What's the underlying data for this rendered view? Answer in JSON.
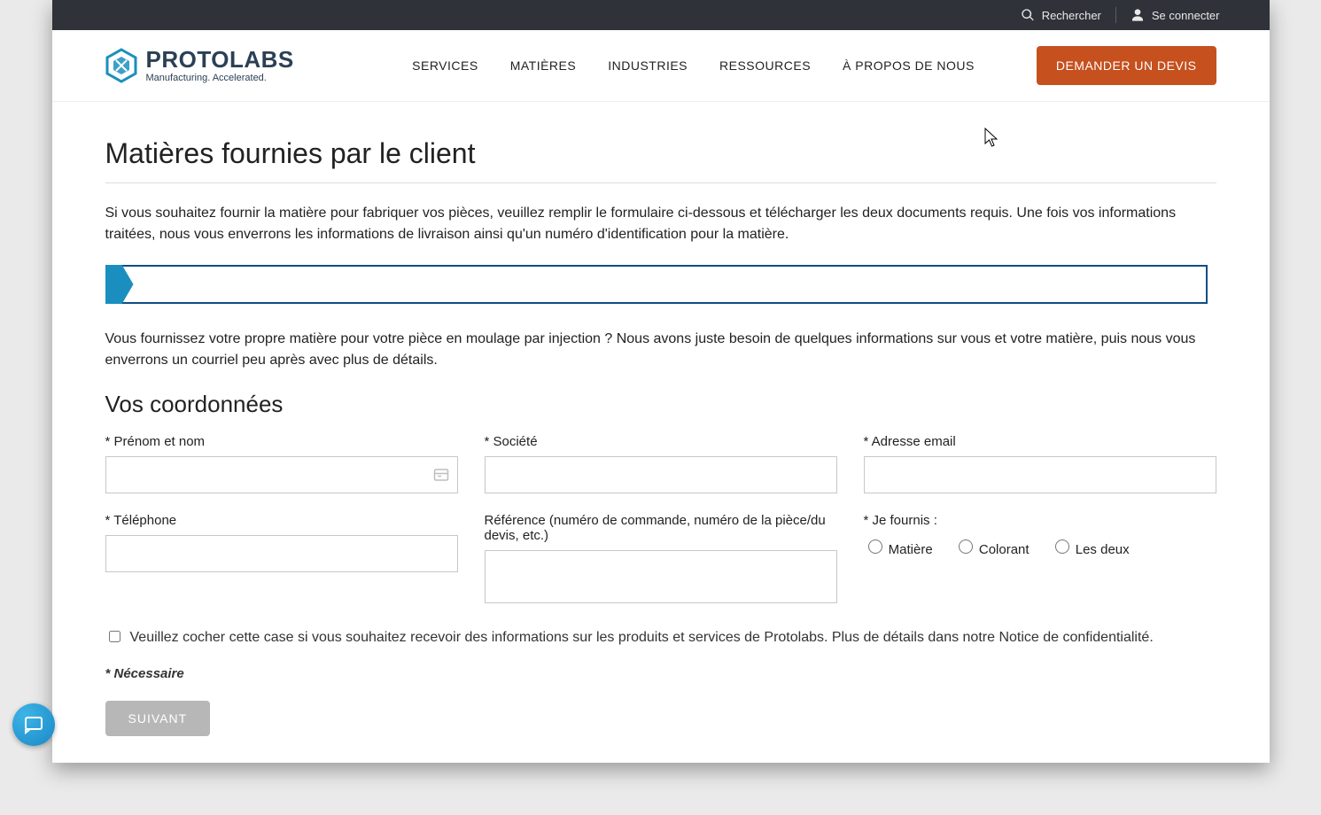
{
  "utility": {
    "search_label": "Rechercher",
    "signin_label": "Se connecter"
  },
  "brand": {
    "name": "PROTOLABS",
    "tagline": "Manufacturing. Accelerated."
  },
  "nav": {
    "items": [
      {
        "label": "SERVICES"
      },
      {
        "label": "MATIÈRES"
      },
      {
        "label": "INDUSTRIES"
      },
      {
        "label": "RESSOURCES"
      },
      {
        "label": "À PROPOS DE NOUS"
      }
    ],
    "cta_label": "DEMANDER UN DEVIS"
  },
  "page": {
    "title": "Matières fournies par le client",
    "intro": "Si vous souhaitez fournir la matière pour fabriquer vos pièces, veuillez remplir le formulaire ci-dessous et télécharger les deux documents requis. Une fois vos informations traitées, nous vous enverrons les informations de livraison ainsi qu'un numéro d'identification pour la matière.",
    "sub": "Vous fournissez votre propre matière pour votre pièce en moulage par injection ? Nous avons juste besoin de quelques informations sur vous et votre matière, puis nous vous enverrons un courriel peu après avec plus de détails."
  },
  "form": {
    "section_title": "Vos coordonnées",
    "fields": {
      "name": {
        "label": "* Prénom et nom",
        "value": ""
      },
      "company": {
        "label": "* Société",
        "value": ""
      },
      "email": {
        "label": "* Adresse email",
        "value": ""
      },
      "phone": {
        "label": "* Téléphone",
        "value": ""
      },
      "reference": {
        "label": "Référence (numéro de commande, numéro de la pièce/du devis, etc.)",
        "value": ""
      },
      "supply": {
        "label": "* Je fournis :",
        "options": [
          {
            "label": "Matière"
          },
          {
            "label": "Colorant"
          },
          {
            "label": "Les deux"
          }
        ]
      }
    },
    "consent_label": "Veuillez cocher cette case si vous souhaitez recevoir des informations sur les produits et services de Protolabs. Plus de détails dans notre Notice de confidentialité.",
    "required_note": "* Nécessaire",
    "next_label": "SUIVANT"
  }
}
